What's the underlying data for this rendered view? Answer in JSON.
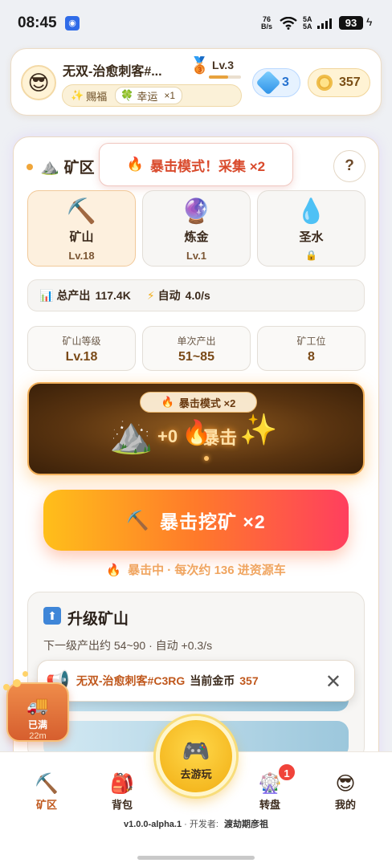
{
  "status_bar": {
    "time": "08:45",
    "net_speed_top": "76",
    "net_speed_bottom": "B/s",
    "sig_top": "5A",
    "sig_bottom": "5A",
    "battery": "93"
  },
  "header": {
    "username": "无双-治愈刺客#...",
    "level": "Lv.3",
    "level_progress": 0.6,
    "bless_label": "赐福",
    "luck_label": "幸运",
    "luck_mult": "×1",
    "gems": "3",
    "coins": "357"
  },
  "mine": {
    "section_title": "矿区",
    "toast": "暴击模式！采集 ×2",
    "help": "?",
    "tabs": [
      {
        "name": "矿山",
        "level": "Lv.18",
        "icon": "pickaxe-icon"
      },
      {
        "name": "炼金",
        "level": "Lv.1",
        "icon": "crystal-ball-icon"
      },
      {
        "name": "圣水",
        "level": "",
        "icon": "droplet-icon",
        "locked": true
      }
    ],
    "total_output_label": "总产出",
    "total_output_value": "117.4K",
    "auto_label": "自动",
    "auto_value": "4.0/s",
    "mini_stats": [
      {
        "label": "矿山等级",
        "value": "Lv.18"
      },
      {
        "label": "单次产出",
        "value": "51~85"
      },
      {
        "label": "矿工位",
        "value": "8"
      }
    ],
    "crit_mode_pill": "暴击模式 ×2",
    "scene_plus": "+0",
    "scene_crit_text": "暴击",
    "main_button": "暴击挖矿 ×2",
    "hint": "暴击中 · 每次约 136 进资源车"
  },
  "upgrade": {
    "title": "升级矿山",
    "desc": "下一级产出约 54~90 · 自动 +0.3/s"
  },
  "notice": {
    "name": "无双-治愈刺客#C3RG",
    "text": "当前金币",
    "coins": "357"
  },
  "cart": {
    "status": "已满",
    "time": "22m"
  },
  "nav": {
    "items": [
      {
        "label": "矿区",
        "icon": "pickaxe-icon"
      },
      {
        "label": "背包",
        "icon": "backpack-icon"
      },
      {
        "label": "去游玩",
        "icon": "gamepad-icon"
      },
      {
        "label": "转盘",
        "icon": "ferris-wheel-icon"
      },
      {
        "label": "我的",
        "icon": "sunglasses-face-icon"
      }
    ],
    "wheel_badge": "1"
  },
  "footer": {
    "version": "v1.0.0-alpha.1",
    "dev_label": "开发者:",
    "dev_name": "渡劫期彦祖"
  },
  "colors": {
    "accent_orange": "#ff7a2a",
    "crit_red": "#d94a2c",
    "gem_blue": "#2672d0",
    "coin_gold": "#e6a82c"
  }
}
